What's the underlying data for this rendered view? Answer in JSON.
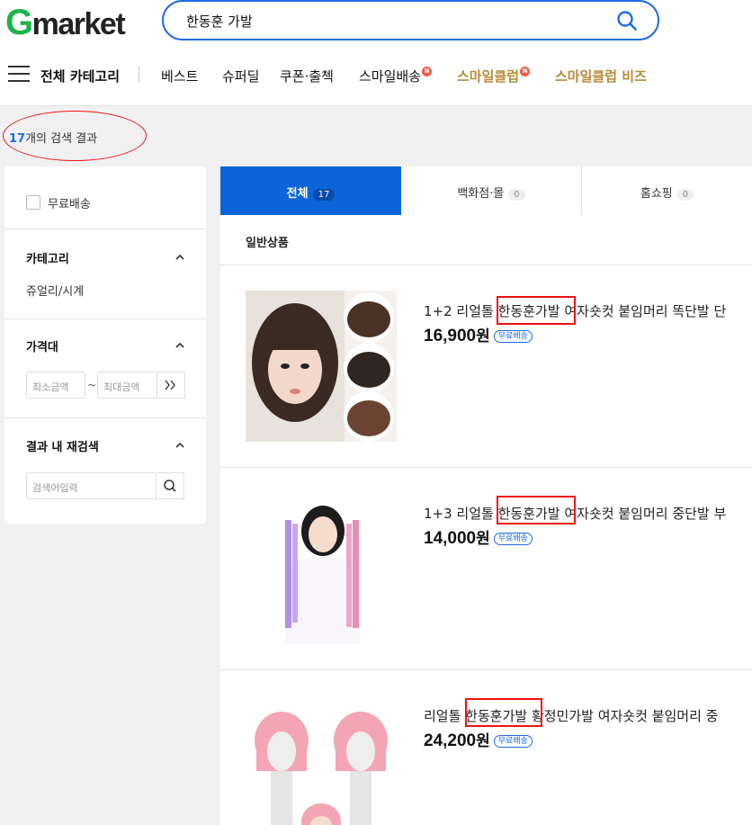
{
  "header": {
    "logo_g": "G",
    "logo_rest": "market",
    "search_query": "한동훈 가발"
  },
  "nav": {
    "all_category": "전체 카테고리",
    "items": [
      "베스트",
      "슈퍼딜",
      "쿠폰·출첵",
      "스마일배송",
      "스마일클럽",
      "스마일클럽 비즈"
    ],
    "badge": "N"
  },
  "result": {
    "count": "17",
    "suffix": "개의 검색 결과"
  },
  "sidebar": {
    "free_shipping": "무료배송",
    "category_title": "카테고리",
    "category_item": "쥬얼리/시계",
    "price_title": "가격대",
    "min_placeholder": "최소금액",
    "tilde": "~",
    "max_placeholder": "최대금액",
    "research_title": "결과 내 재검색",
    "research_placeholder": "검색어입력"
  },
  "tabs": [
    {
      "label": "전체",
      "count": "17"
    },
    {
      "label": "백화점·몰",
      "count": "0"
    },
    {
      "label": "홈쇼핑",
      "count": "0"
    }
  ],
  "section_title": "일반상품",
  "products": [
    {
      "pre": "1+2 리얼톨 ",
      "hl": "한동훈가발",
      "post": " 여자숏컷 붙임머리 똑단발 단",
      "price": "16,900",
      "won": "원",
      "free": "무료배송"
    },
    {
      "pre": "1+3 리얼톨 ",
      "hl": "한동훈가발",
      "post": " 여자숏컷 붙임머리 중단발 부",
      "price": "14,000",
      "won": "원",
      "free": "무료배송"
    },
    {
      "pre": "리얼톨 ",
      "hl": "한동훈가발",
      "post": " 황정민가발 여자숏컷 붙임머리 중",
      "price": "24,200",
      "won": "원",
      "free": "무료배송"
    }
  ],
  "colors": {
    "brand_green": "#1db34d",
    "accent_blue": "#1e6be6",
    "tab_active": "#0b65d9",
    "gold": "#b98a3a",
    "annotation_red": "#e11111"
  }
}
